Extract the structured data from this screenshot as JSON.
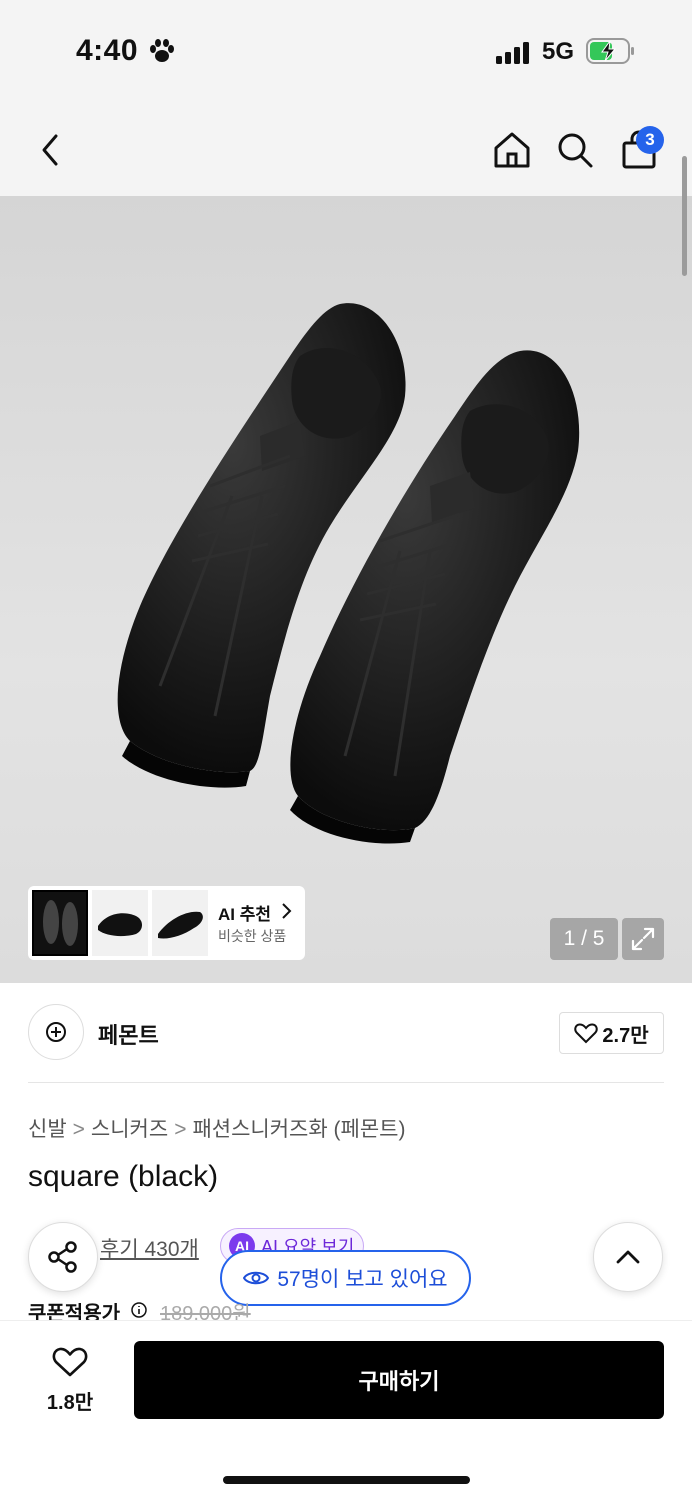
{
  "status": {
    "time": "4:40",
    "network": "5G"
  },
  "header": {
    "cart_count": "3"
  },
  "gallery": {
    "counter": "1 / 5",
    "ai_title": "AI 추천",
    "ai_subtitle": "비슷한 상품"
  },
  "brand": {
    "name": "페몬트",
    "likes": "2.7만"
  },
  "breadcrumb": [
    "신발",
    "스니커즈",
    "패션스니커즈화 (페몬트)"
  ],
  "product": {
    "name": "square (black)",
    "reviews": "후기 430개",
    "ai_summary": "AI 요약 보기",
    "ai_badge": "AI",
    "viewers": "57명이 보고 있어요",
    "price_label": "쿠폰적용가",
    "original_price": "189,000원"
  },
  "bottom": {
    "wish_count": "1.8만",
    "buy_label": "구매하기"
  },
  "colors": {
    "accent": "#2563eb",
    "ai_purple": "#7c3aed",
    "battery_green": "#34c759"
  },
  "icons": [
    "paw-icon",
    "back-icon",
    "home-icon",
    "search-icon",
    "bag-icon",
    "expand-icon",
    "heart-icon",
    "share-icon",
    "chevron-up-icon",
    "eye-icon",
    "info-icon"
  ]
}
